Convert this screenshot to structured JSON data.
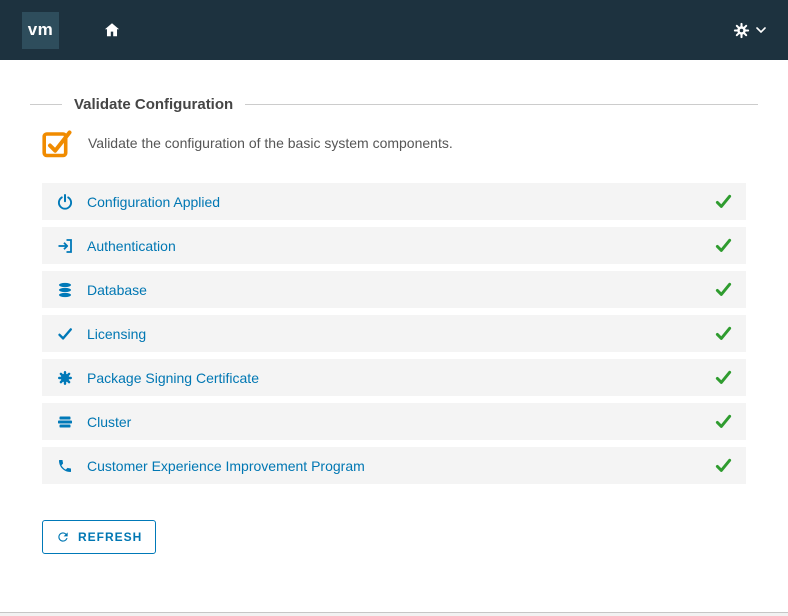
{
  "header": {
    "logo_text": "vm"
  },
  "page": {
    "title": "Validate Configuration",
    "description": "Validate the configuration of the basic system components."
  },
  "checks": [
    {
      "label": "Configuration Applied",
      "icon": "power-icon",
      "status": "success"
    },
    {
      "label": "Authentication",
      "icon": "login-icon",
      "status": "success"
    },
    {
      "label": "Database",
      "icon": "database-icon",
      "status": "success"
    },
    {
      "label": "Licensing",
      "icon": "check-icon",
      "status": "success"
    },
    {
      "label": "Package Signing Certificate",
      "icon": "certificate-icon",
      "status": "success"
    },
    {
      "label": "Cluster",
      "icon": "cluster-icon",
      "status": "success"
    },
    {
      "label": "Customer Experience Improvement Program",
      "icon": "phone-icon",
      "status": "success"
    }
  ],
  "actions": {
    "refresh_label": "REFRESH"
  },
  "colors": {
    "header_bg": "#1d323f",
    "accent_blue": "#0079b8",
    "link_blue": "#0077b3",
    "success_green": "#2f9c2f",
    "warning_orange": "#f08b00",
    "row_bg": "#f4f4f4",
    "title_text": "#454545"
  }
}
